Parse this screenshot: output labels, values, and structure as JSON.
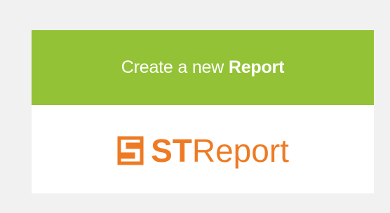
{
  "create_button": {
    "prefix": "Create a new ",
    "bold": "Report"
  },
  "logo": {
    "bold": "ST",
    "light": "Report",
    "icon": "st-report-logo-icon"
  },
  "colors": {
    "background": "#f1f1f1",
    "card": "#ffffff",
    "accent_green": "#93c236",
    "logo_orange": "#ee7b23",
    "button_text": "#ffffff"
  }
}
